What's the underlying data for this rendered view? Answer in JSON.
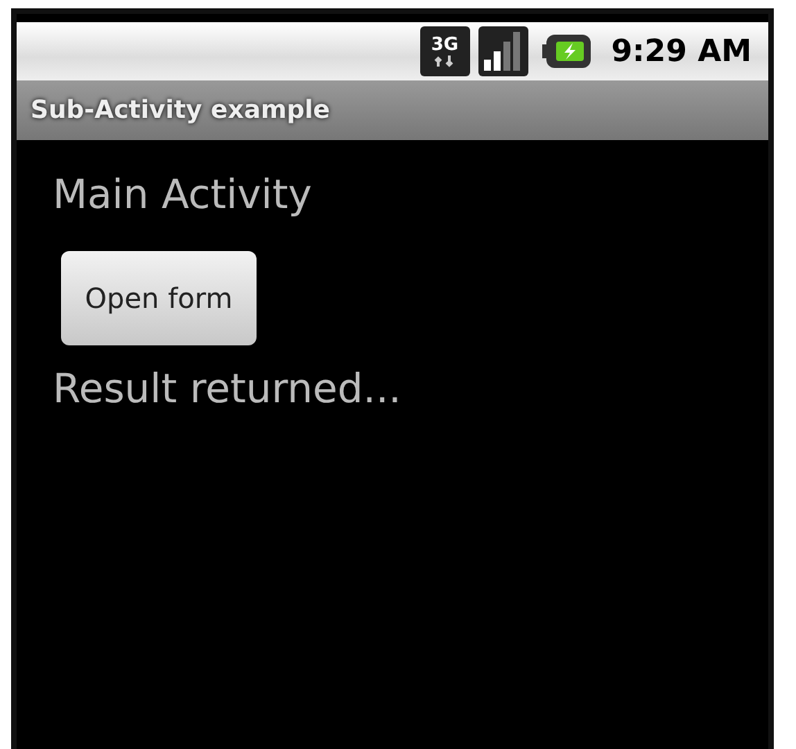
{
  "status_bar": {
    "network": "3G",
    "time": "9:29 AM"
  },
  "title_bar": {
    "title": "Sub-Activity example"
  },
  "content": {
    "heading": "Main Activity",
    "button": "Open form",
    "result": "Result returned..."
  }
}
